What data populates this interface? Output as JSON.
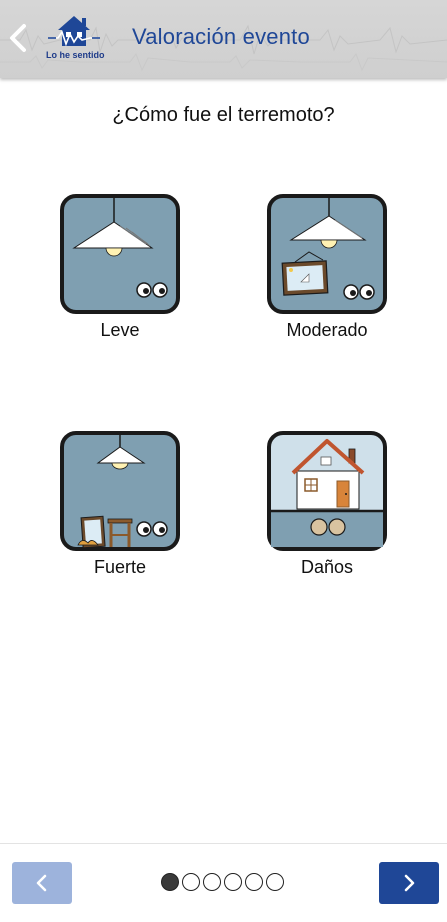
{
  "header": {
    "title": "Valoración evento",
    "logo_text": "Lo he sentido",
    "back_icon": "chevron-left-icon"
  },
  "main": {
    "question": "¿Cómo fue el terremoto?",
    "options": [
      {
        "label": "Leve",
        "icon": "lamp-eyes-icon"
      },
      {
        "label": "Moderado",
        "icon": "lamp-picture-eyes-icon"
      },
      {
        "label": "Fuerte",
        "icon": "lamp-fallen-furniture-icon"
      },
      {
        "label": "Daños",
        "icon": "damaged-house-icon"
      }
    ]
  },
  "footer": {
    "prev_icon": "chevron-left-icon",
    "next_icon": "chevron-right-icon",
    "steps_total": 6,
    "step_current": 1
  },
  "colors": {
    "brand_blue": "#1f4797",
    "prev_button": "#9db3dc",
    "tile_background": "#7f9fb1",
    "tile_border": "#1a1a1a",
    "header_background": "#d3d3d3"
  }
}
